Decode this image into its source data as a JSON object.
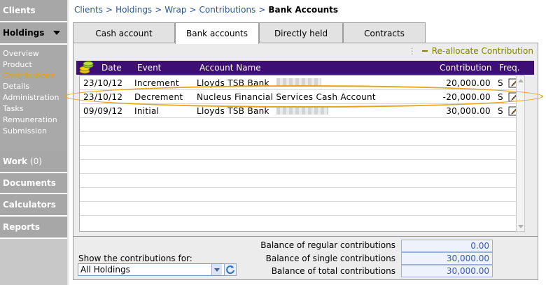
{
  "sidebar": {
    "clients": "Clients",
    "holdings": "Holdings",
    "subnav": [
      "Overview",
      "Product",
      "Contributions",
      "Details",
      "Administration",
      "Tasks",
      "Remuneration",
      "Submission"
    ],
    "work": "Work",
    "work_count": "(0)",
    "documents": "Documents",
    "calculators": "Calculators",
    "reports": "Reports"
  },
  "breadcrumb": {
    "items": [
      "Clients",
      "Holdings",
      "Wrap",
      "Contributions"
    ],
    "separator": ">",
    "current": "Bank Accounts"
  },
  "tabs": [
    "Cash account",
    "Bank accounts",
    "Directly held",
    "Contracts"
  ],
  "actions": {
    "reallocate": "Re-allocate Contribution"
  },
  "table": {
    "columns": [
      "Date",
      "Event",
      "Account Name",
      "Contribution",
      "Freq."
    ],
    "rows": [
      {
        "date": "23/10/12",
        "event": "Increment",
        "account": "Lloyds TSB Bank",
        "contribution": "20,000.00",
        "freq": "S"
      },
      {
        "date": "23/10/12",
        "event": "Decrement",
        "account": "Nucleus Financial Services Cash Account",
        "contribution": "-20,000.00",
        "freq": "S"
      },
      {
        "date": "09/09/12",
        "event": "Initial",
        "account": "Lloyds TSB Bank",
        "contribution": "30,000.00",
        "freq": "S"
      }
    ]
  },
  "footer": {
    "show_label": "Show the contributions for:",
    "filter_value": "All Holdings",
    "balances": [
      {
        "label": "Balance of regular contributions",
        "value": "0.00"
      },
      {
        "label": "Balance of single contributions",
        "value": "30,000.00"
      },
      {
        "label": "Balance of total contributions",
        "value": "30,000.00"
      }
    ]
  },
  "colors": {
    "header_bg": "#3d0f74",
    "link": "#2a55a0",
    "highlight": "#e8a21a",
    "sidebar_active": "#f0a000"
  },
  "icons": [
    "coins-icon",
    "edit-icon",
    "dropdown-arrow-icon",
    "refresh-icon"
  ]
}
